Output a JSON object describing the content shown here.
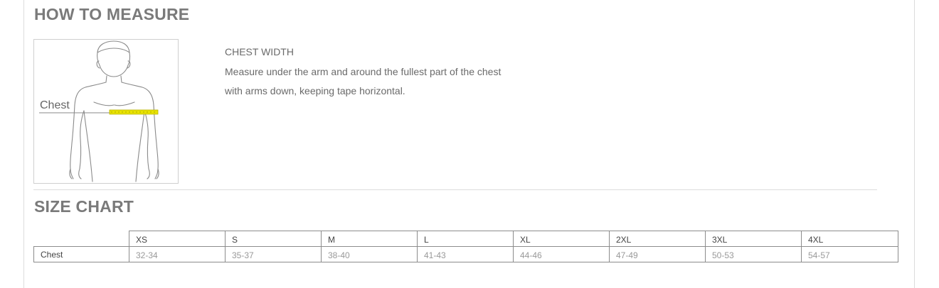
{
  "how_to_measure": {
    "title": "HOW TO MEASURE",
    "figure_label": "Chest",
    "measurement_name": "CHEST WIDTH",
    "instruction_line1": "Measure under the arm and around the fullest part of the chest",
    "instruction_line2": "with arms down, keeping tape horizontal.",
    "tape_color": "#e8e200"
  },
  "size_chart": {
    "title": "SIZE CHART",
    "sizes": [
      "XS",
      "S",
      "M",
      "L",
      "XL",
      "2XL",
      "3XL",
      "4XL"
    ],
    "rows": [
      {
        "label": "Chest",
        "values": [
          "32-34",
          "35-37",
          "38-40",
          "41-43",
          "44-46",
          "47-49",
          "50-53",
          "54-57"
        ]
      }
    ]
  }
}
